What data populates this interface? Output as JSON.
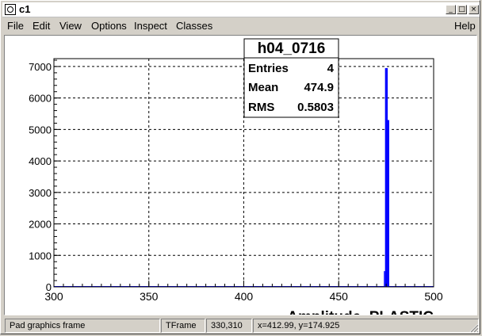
{
  "window": {
    "title": "c1"
  },
  "window_buttons": {
    "minimize": "_",
    "maximize": "□",
    "close": "×"
  },
  "menu": [
    "File",
    "Edit",
    "View",
    "Options",
    "Inspect",
    "Classes"
  ],
  "menu_help": "Help",
  "stats": {
    "name": "h04_0716",
    "rows": [
      {
        "label": "Entries",
        "value": "4"
      },
      {
        "label": "Mean",
        "value": "474.9"
      },
      {
        "label": "RMS",
        "value": "0.5803"
      }
    ]
  },
  "chart_data": {
    "type": "bar",
    "xlabel": "Amplitude_PLASTIC",
    "ylabel": "",
    "xlim": [
      300,
      500
    ],
    "ylim": [
      0,
      7250
    ],
    "x_ticks": [
      "300",
      "350",
      "400",
      "450",
      "500"
    ],
    "y_ticks": [
      "0",
      "1000",
      "2000",
      "3000",
      "4000",
      "5000",
      "6000",
      "7000"
    ],
    "grid": true,
    "color": "#0000ff",
    "bins": [
      {
        "x0": 473.8,
        "x1": 474.4,
        "value": 500
      },
      {
        "x0": 474.4,
        "x1": 475.8,
        "value": 6950
      },
      {
        "x0": 475.8,
        "x1": 476.6,
        "value": 5300
      }
    ]
  },
  "status": {
    "object": "Pad graphics frame",
    "class": "TFrame",
    "pixel": "330,310",
    "coords": "x=412.99, y=174.925"
  }
}
